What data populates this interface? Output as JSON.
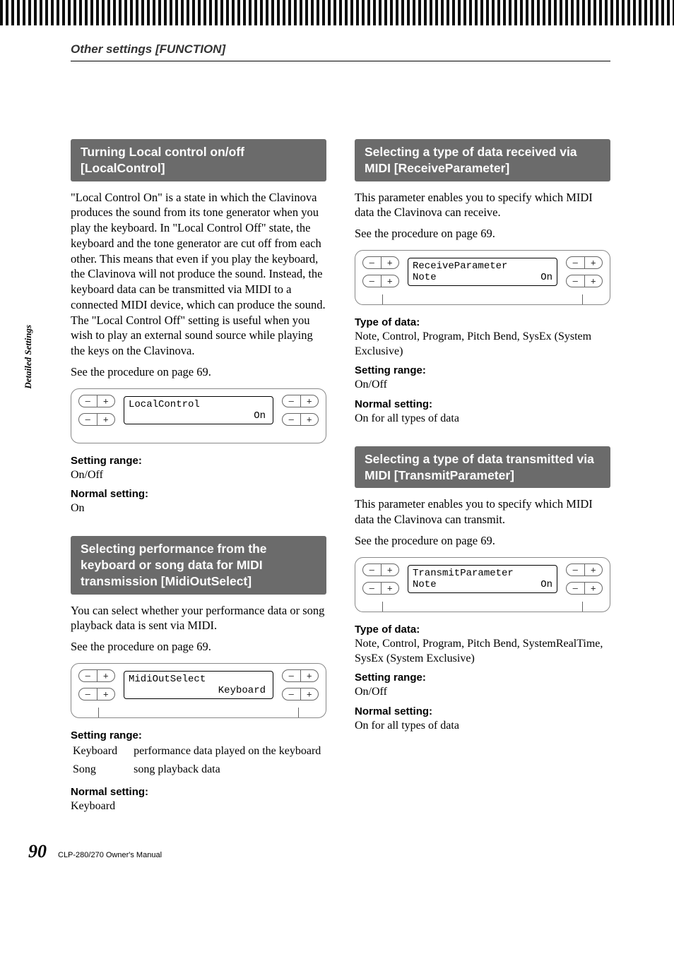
{
  "breadcrumb": "Other settings [FUNCTION]",
  "side_tab": "Detailed Settings",
  "footer": {
    "page": "90",
    "title": "CLP-280/270 Owner's Manual"
  },
  "btn": {
    "minus": "–",
    "plus": "+"
  },
  "sections": {
    "local_control": {
      "title": "Turning Local control on/off [LocalControl]",
      "body": "\"Local Control On\" is a state in which the Clavinova produces the sound from its tone generator when you play the keyboard. In \"Local Control Off\" state, the keyboard and the tone generator are cut off from each other. This means that even if you play the keyboard, the Clavinova will not produce the sound. Instead, the keyboard data can be transmitted via MIDI to a connected MIDI device, which can produce the sound. The \"Local Control Off\" setting is useful when you wish to play an external sound source while playing the keys on the Clavinova.",
      "see": "See the procedure on page 69.",
      "lcd": {
        "line1": "LocalControl",
        "line2": "On"
      },
      "range_label": "Setting range:",
      "range": "On/Off",
      "normal_label": "Normal setting:",
      "normal": "On"
    },
    "midi_out_select": {
      "title": "Selecting performance from the keyboard or song data for MIDI transmission [MidiOutSelect]",
      "body": "You can select whether your performance data or song playback data is sent via MIDI.",
      "see": "See the procedure on page 69.",
      "lcd": {
        "line1": "MidiOutSelect",
        "line2": "Keyboard"
      },
      "range_label": "Setting range:",
      "range_rows": [
        {
          "k": "Keyboard",
          "v": "performance data played on the keyboard"
        },
        {
          "k": "Song",
          "v": "song playback data"
        }
      ],
      "normal_label": "Normal setting:",
      "normal": "Keyboard"
    },
    "receive_param": {
      "title": "Selecting a type of data received via MIDI [ReceiveParameter]",
      "body": "This parameter enables you to specify which MIDI data the Clavinova can receive.",
      "see": "See the procedure on page 69.",
      "lcd": {
        "line1": "ReceiveParameter",
        "line2l": "Note",
        "line2r": "On"
      },
      "type_label": "Type of data:",
      "type": "Note, Control, Program, Pitch Bend, SysEx (System Exclusive)",
      "range_label": "Setting range:",
      "range": "On/Off",
      "normal_label": "Normal setting:",
      "normal": "On for all types of data"
    },
    "transmit_param": {
      "title": "Selecting a type of data transmitted via MIDI [TransmitParameter]",
      "body": "This parameter enables you to specify which MIDI data the Clavinova can transmit.",
      "see": "See the procedure on page 69.",
      "lcd": {
        "line1": "TransmitParameter",
        "line2l": "Note",
        "line2r": "On"
      },
      "type_label": "Type of data:",
      "type": "Note, Control, Program, Pitch Bend, SystemRealTime, SysEx (System Exclusive)",
      "range_label": "Setting range:",
      "range": "On/Off",
      "normal_label": "Normal setting:",
      "normal": "On for all types of data"
    }
  }
}
